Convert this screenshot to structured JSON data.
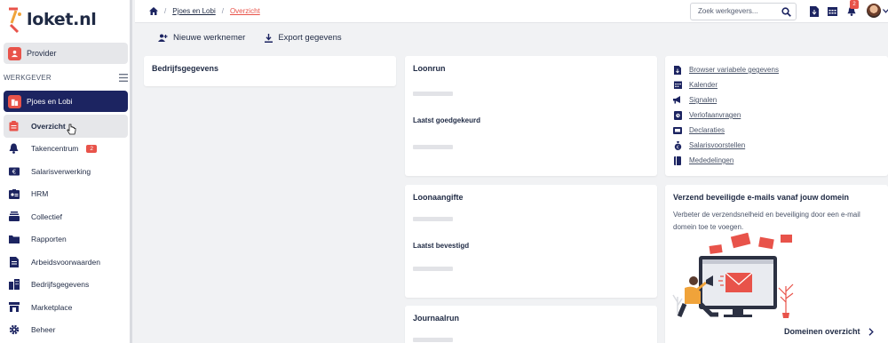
{
  "app": {
    "logo_text": "loket.nl"
  },
  "sidebar": {
    "provider_label": "Provider",
    "section_title": "WERKGEVER",
    "company_label": "Pjoes en Lobi",
    "items": [
      {
        "label": "Overzicht",
        "icon": "clipboard-icon",
        "active": true
      },
      {
        "label": "Takencentrum",
        "icon": "bell-icon",
        "badge": "2"
      },
      {
        "label": "Salarisverwerking",
        "icon": "money-icon"
      },
      {
        "label": "HRM",
        "icon": "id-card-icon"
      },
      {
        "label": "Collectief",
        "icon": "stack-icon"
      },
      {
        "label": "Rapporten",
        "icon": "folder-icon"
      },
      {
        "label": "Arbeidsvoorwaarden",
        "icon": "document-icon"
      },
      {
        "label": "Bedrijfsgegevens",
        "icon": "building-icon"
      },
      {
        "label": "Marketplace",
        "icon": "store-icon"
      },
      {
        "label": "Beheer",
        "icon": "gear-icon"
      }
    ]
  },
  "topbar": {
    "breadcrumb": [
      "Pjoes en Lobi",
      "Overzicht"
    ],
    "search_placeholder": "Zoek werkgevers...",
    "notification_count": "2"
  },
  "actions": {
    "new_employee": "Nieuwe werknemer",
    "export": "Export gegevens"
  },
  "cards": {
    "bedrijfsgegevens": {
      "title": "Bedrijfsgegevens"
    },
    "loonrun": {
      "title": "Loonrun",
      "sub": "Laatst goedgekeurd"
    },
    "loonaangifte": {
      "title": "Loonaangifte",
      "sub": "Laatst bevestigd"
    },
    "journaalrun": {
      "title": "Journaalrun"
    },
    "quicklinks": [
      {
        "label": "Browser variabele gegevens",
        "icon": "file-icon"
      },
      {
        "label": "Kalender",
        "icon": "calendar-icon"
      },
      {
        "label": "Signalen",
        "icon": "megaphone-icon"
      },
      {
        "label": "Verlofaanvragen",
        "icon": "leave-icon"
      },
      {
        "label": "Declaraties",
        "icon": "receipt-icon"
      },
      {
        "label": "Salarisvoorstellen",
        "icon": "money-bag-icon"
      },
      {
        "label": "Mededelingen",
        "icon": "book-icon"
      }
    ],
    "promo": {
      "title": "Verzend beveiligde e-mails vanaf jouw domein",
      "text": "Verbeter de verzendsnelheid en beveiliging door een e-mail domein toe te voegen.",
      "link": "Domeinen overzicht"
    }
  },
  "colors": {
    "navy": "#1c2461",
    "accent": "#e8534a"
  }
}
